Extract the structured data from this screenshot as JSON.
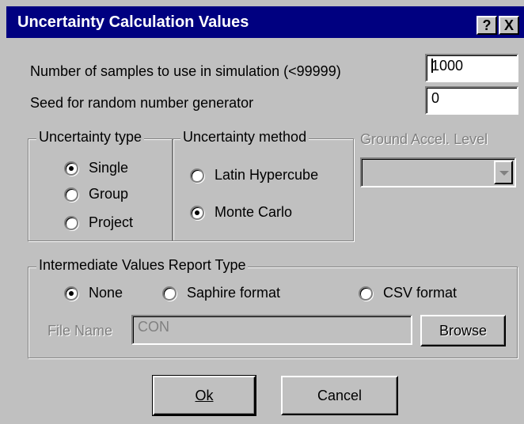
{
  "window": {
    "title": "Uncertainty Calculation Values",
    "help_label": "?",
    "close_label": "X"
  },
  "samples": {
    "label": "Number of samples to use in simulation (<99999)",
    "value": "1000"
  },
  "seed": {
    "label": "Seed for random number generator",
    "value": "0"
  },
  "uncertainty_type": {
    "title": "Uncertainty type",
    "options": [
      "Single",
      "Group",
      "Project"
    ],
    "selected": "Single"
  },
  "uncertainty_method": {
    "title": "Uncertainty method",
    "options": [
      "Latin Hypercube",
      "Monte Carlo"
    ],
    "selected": "Monte Carlo"
  },
  "ground_accel": {
    "title": "Ground Accel. Level",
    "value": ""
  },
  "report": {
    "title": "Intermediate Values Report Type",
    "options": [
      "None",
      "Saphire format",
      "CSV format"
    ],
    "selected": "None",
    "file_label": "File Name",
    "file_value": "CON",
    "browse_label": "Browse"
  },
  "buttons": {
    "ok": "Ok",
    "cancel": "Cancel"
  }
}
